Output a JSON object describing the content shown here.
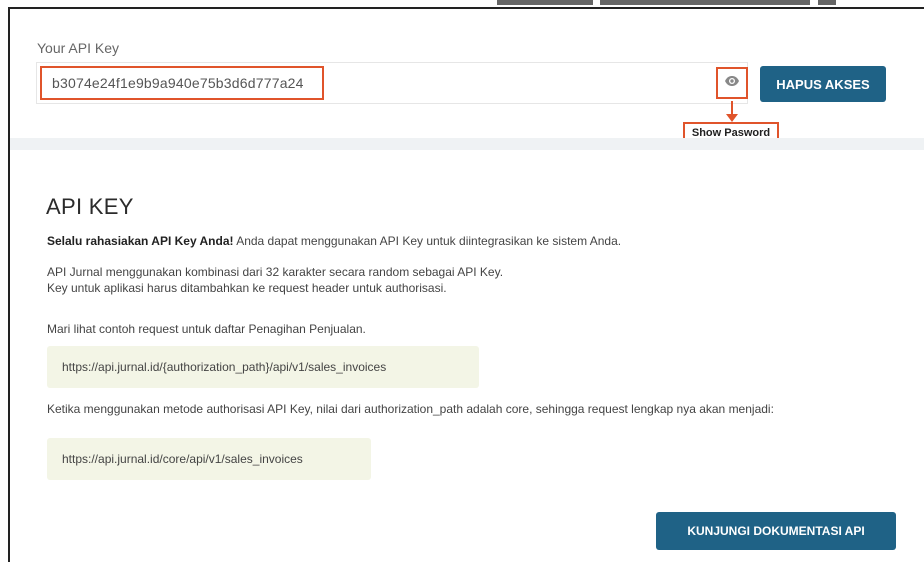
{
  "api_key": {
    "label": "Your API Key",
    "value": "b3074e24f1e9b9a940e75b3d6d777a24",
    "show_password_icon": "eye-icon",
    "tooltip": "Show Pasword",
    "revoke_button": "HAPUS AKSES"
  },
  "doc": {
    "title": "API KEY",
    "intro_bold": "Selalu rahasiakan API Key Anda!",
    "intro_rest": " Anda dapat menggunakan API Key untuk diintegrasikan ke sistem Anda.",
    "combination_line1": "API Jurnal menggunakan kombinasi dari 32 karakter secara random sebagai API Key.",
    "combination_line2": "Key untuk aplikasi harus ditambahkan ke request header untuk authorisasi.",
    "example_intro": "Mari lihat contoh request untuk daftar Penagihan Penjualan.",
    "example_url": "https://api.jurnal.id/{authorization_path}/api/v1/sales_invoices",
    "auth_note": "Ketika menggunakan metode authorisasi API Key, nilai dari authorization_path adalah core, sehingga request lengkap nya akan menjadi:",
    "final_url": "https://api.jurnal.id/core/api/v1/sales_invoices",
    "docs_button": "KUNJUNGI DOKUMENTASI API"
  },
  "colors": {
    "primary_button": "#1f6286",
    "highlight": "#e0542b",
    "code_background": "#f3f5e6"
  }
}
